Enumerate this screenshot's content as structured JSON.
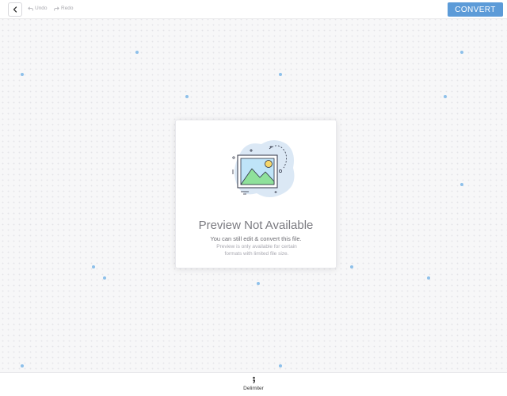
{
  "toolbar": {
    "undo_label": "Undo",
    "redo_label": "Redo",
    "convert_label": "CONVERT"
  },
  "preview": {
    "title": "Preview Not Available",
    "subtitle": "You can still edit & convert this file.",
    "note_line1": "Preview is only available for certain",
    "note_line2": "formats with limited file size."
  },
  "bottom_bar": {
    "delimiter_label": "Delimiter"
  },
  "icons": {
    "back": "chevron-left-icon",
    "undo": "undo-icon",
    "redo": "redo-icon",
    "delimiter": "semicolon-icon",
    "preview": "image-placeholder-icon"
  },
  "colors": {
    "accent": "#5c9bd8",
    "dots": "#8dc0ea",
    "illustration_blob": "#dbe8f5",
    "mountain": "#8fe19b",
    "sun": "#f5d66a"
  }
}
